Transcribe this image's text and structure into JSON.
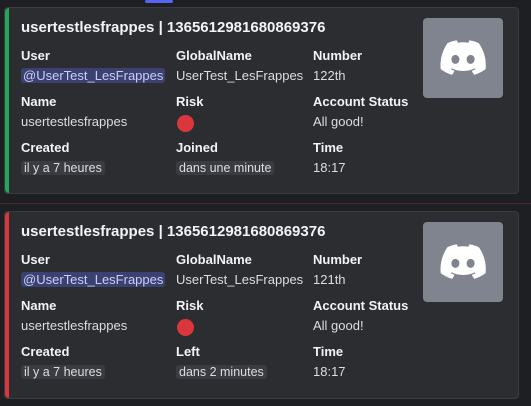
{
  "colors": {
    "accent_green": "#23a55a",
    "accent_red": "#da373c",
    "mention_bg": "#3c4270"
  },
  "embeds": [
    {
      "title": "usertestlesfrappes | 1365612981680869376",
      "user_label": "User",
      "user_value": "@UserTest_LesFrappes",
      "globalname_label": "GlobalName",
      "globalname_value": "UserTest_LesFrappes",
      "number_label": "Number",
      "number_value": "122th",
      "name_label": "Name",
      "name_value": "usertestlesfrappes",
      "risk_label": "Risk",
      "status_label": "Account Status",
      "status_value": "All good!",
      "created_label": "Created",
      "created_value": "il y a 7 heures",
      "event_label": "Joined",
      "event_value": "dans une minute",
      "time_label": "Time",
      "time_value": "18:17",
      "thumbnail_icon": "discord-logo-icon"
    },
    {
      "title": "usertestlesfrappes | 1365612981680869376",
      "user_label": "User",
      "user_value": "@UserTest_LesFrappes",
      "globalname_label": "GlobalName",
      "globalname_value": "UserTest_LesFrappes",
      "number_label": "Number",
      "number_value": "121th",
      "name_label": "Name",
      "name_value": "usertestlesfrappes",
      "risk_label": "Risk",
      "status_label": "Account Status",
      "status_value": "All good!",
      "created_label": "Created",
      "created_value": "il y a 7 heures",
      "event_label": "Left",
      "event_value": "dans 2 minutes",
      "time_label": "Time",
      "time_value": "18:17",
      "thumbnail_icon": "discord-logo-icon"
    }
  ]
}
